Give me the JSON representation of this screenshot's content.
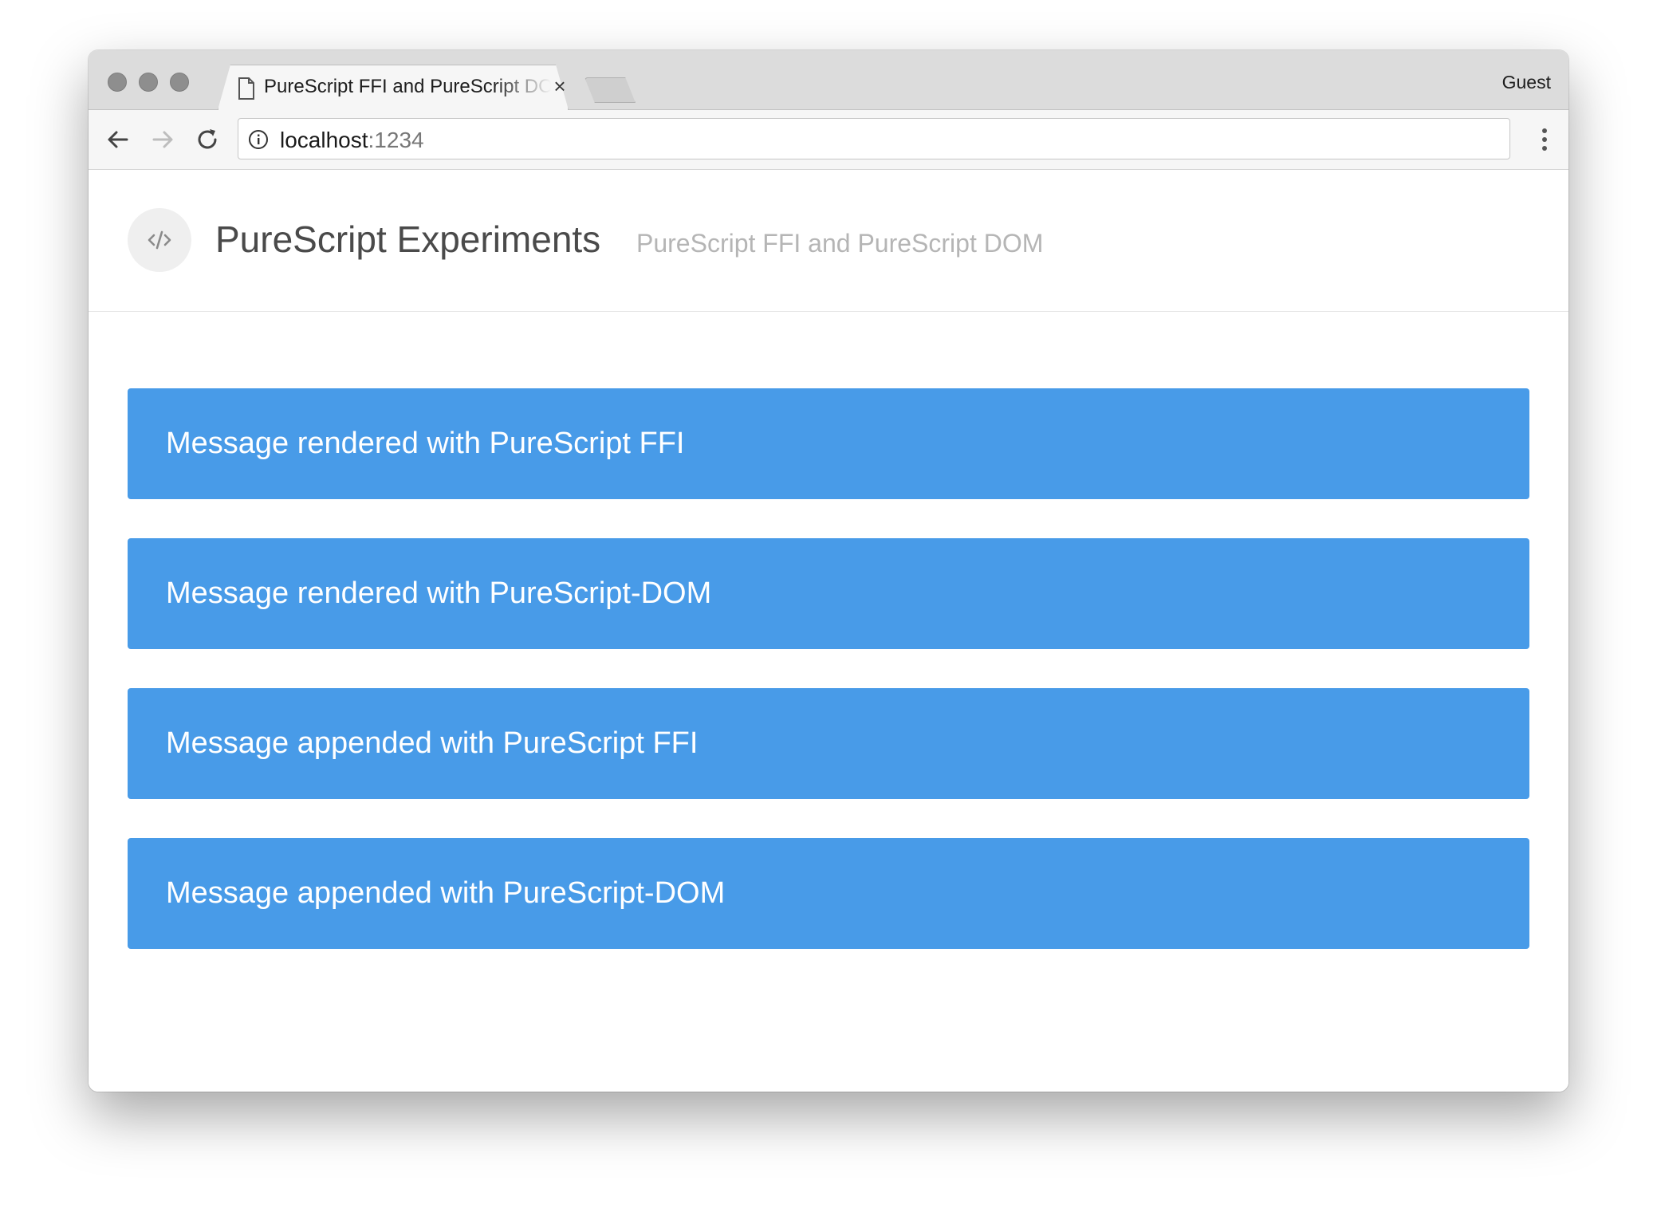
{
  "browser": {
    "tab": {
      "title": "PureScript FFI and PureScript DOM"
    },
    "profile": "Guest",
    "address_bar": {
      "host": "localhost",
      "port": ":1234"
    }
  },
  "page": {
    "header": {
      "title": "PureScript Experiments",
      "subtitle": "PureScript FFI and PureScript DOM"
    },
    "messages": [
      "Message rendered with PureScript FFI",
      "Message rendered with PureScript-DOM",
      "Message appended with PureScript FFI",
      "Message appended with PureScript-DOM"
    ]
  },
  "colors": {
    "message_background": "#489be8",
    "title_text": "#4a4a4a",
    "subtitle_text": "#b5b5b5"
  },
  "icons": {
    "window_controls": [
      "close-dot",
      "minimize-dot",
      "zoom-dot"
    ],
    "tab": [
      "page-icon",
      "close-icon"
    ],
    "toolbar": [
      "back-icon",
      "forward-icon",
      "reload-icon",
      "info-icon",
      "menu-icon"
    ],
    "logo": "code-icon"
  }
}
